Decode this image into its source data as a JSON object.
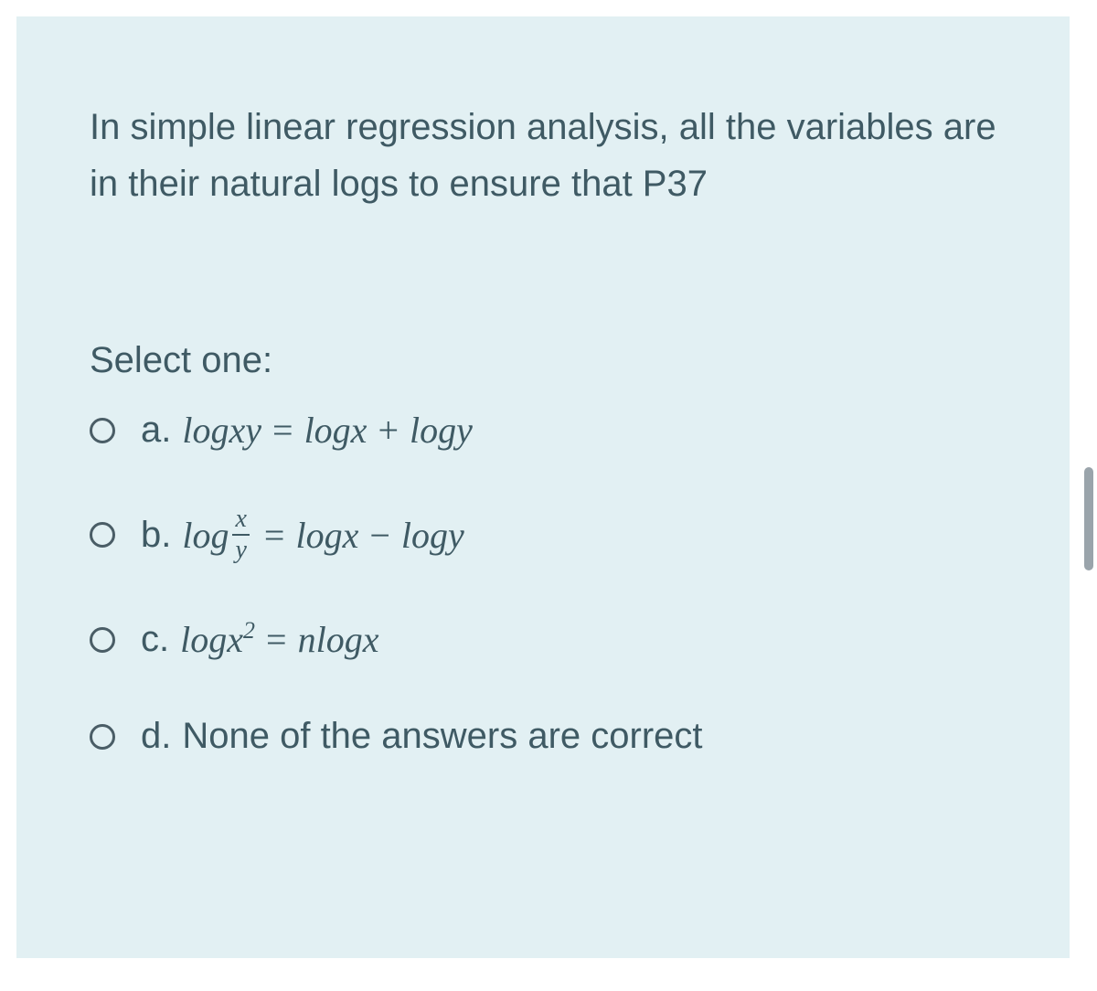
{
  "question": {
    "text": "In simple linear regression analysis, all the variables are in their natural logs to ensure that P37",
    "select_label": "Select one:"
  },
  "options": {
    "a": {
      "letter": "a.",
      "log": "log",
      "xy": "xy",
      "eq": "=",
      "logx": "logx",
      "plus": "+",
      "logy": "logy"
    },
    "b": {
      "letter": "b.",
      "log": "log",
      "frac_num": "x",
      "frac_den": "y",
      "eq": "=",
      "logx": "logx",
      "minus": "−",
      "logy": "logy"
    },
    "c": {
      "letter": "c.",
      "log": "log",
      "x": "x",
      "sup": "2",
      "eq": "=",
      "nlogx": "nlogx"
    },
    "d": {
      "letter": "d.",
      "text": "None of the answers are correct"
    }
  }
}
